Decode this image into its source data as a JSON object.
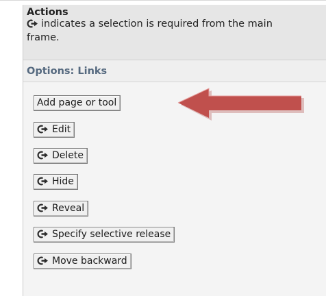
{
  "actions": {
    "title": "Actions",
    "description": "indicates a selection is required from the main frame."
  },
  "options": {
    "header": "Options: Links"
  },
  "buttons": {
    "add_page": "Add page or tool",
    "edit": "Edit",
    "delete": "Delete",
    "hide": "Hide",
    "reveal": "Reveal",
    "specify_release": "Specify selective release",
    "move_backward": "Move backward"
  },
  "icons": {
    "selection_required": "selection-required-icon",
    "callout_arrow": "red-arrow-icon"
  },
  "colors": {
    "arrow_fill": "#c0504d",
    "arrow_shadow": "#d9b3b2",
    "options_text": "#55697f"
  }
}
